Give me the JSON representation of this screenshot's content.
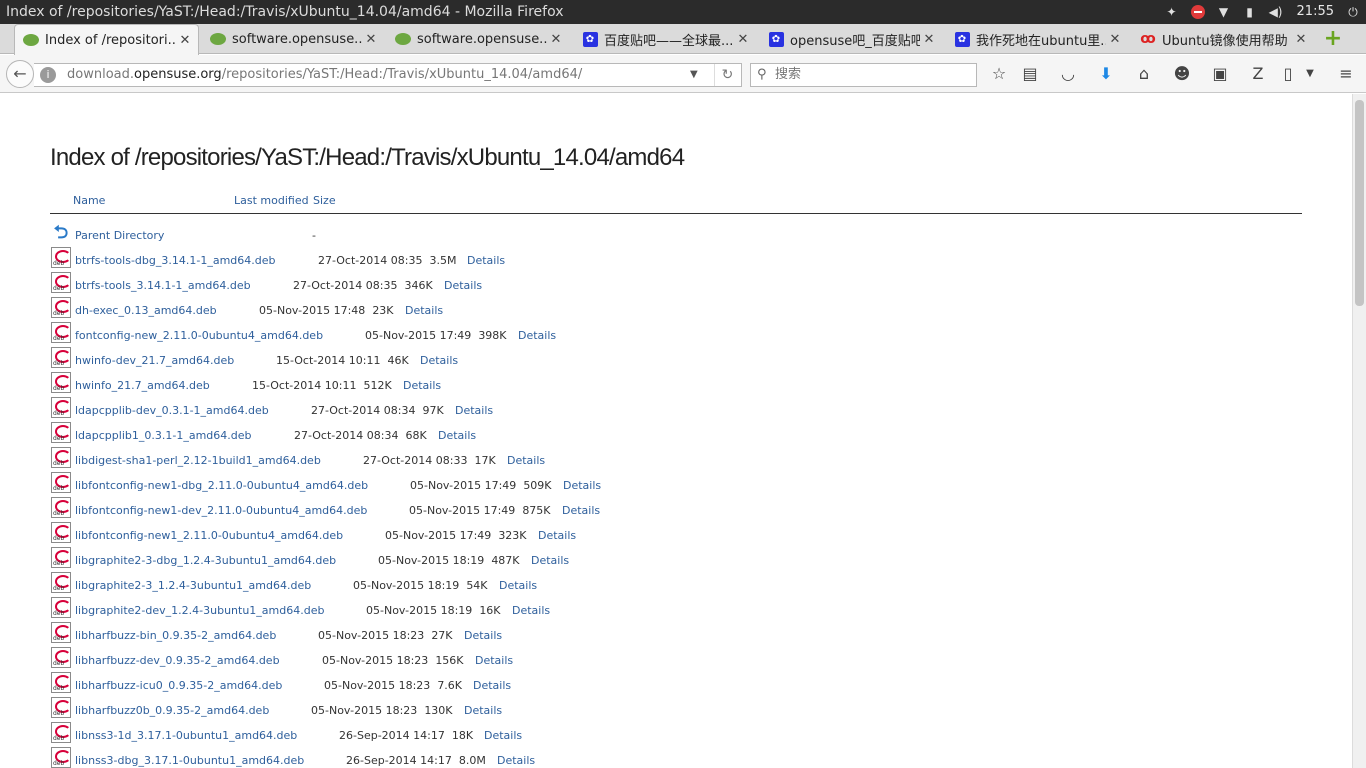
{
  "window": {
    "title": "Index of /repositories/YaST:/Head:/Travis/xUbuntu_14.04/amd64 - Mozilla Firefox"
  },
  "system_tray": {
    "time": "21:55",
    "icons": [
      "network-sparkle-icon",
      "stop-icon",
      "wifi-icon",
      "battery-icon",
      "volume-icon",
      "power-icon"
    ]
  },
  "tabs": [
    {
      "label": "Index of /repositori...",
      "favicon": "opensuse-icon",
      "active": true
    },
    {
      "label": "software.opensuse....",
      "favicon": "opensuse-icon"
    },
    {
      "label": "software.opensuse....",
      "favicon": "opensuse-icon"
    },
    {
      "label": "百度贴吧——全球最...",
      "favicon": "baidu-paw-icon"
    },
    {
      "label": "opensuse吧_百度贴吧",
      "favicon": "baidu-paw-icon"
    },
    {
      "label": "我作死地在ubuntu里...",
      "favicon": "baidu-paw-icon"
    },
    {
      "label": "Ubuntu镜像使用帮助",
      "favicon": "mirror-icon"
    }
  ],
  "navbar": {
    "url_host": "download.opensuse.org",
    "url_path": "/repositories/YaST:/Head:/Travis/xUbuntu_14.04/amd64/",
    "url_prefix": "download.",
    "url_domain": "opensuse.org",
    "search_placeholder": "搜索"
  },
  "page": {
    "title": "Index of /repositories/YaST:/Head:/Travis/xUbuntu_14.04/amd64",
    "col_name": "Name",
    "col_modified": "Last modified",
    "col_size": "Size",
    "parent": {
      "name": "Parent Directory",
      "size": "-"
    },
    "files": [
      {
        "name": "btrfs-tools-dbg_3.14.1-1_amd64.deb",
        "modified": "27-Oct-2014 08:35",
        "size": "3.5M",
        "details": "Details"
      },
      {
        "name": "btrfs-tools_3.14.1-1_amd64.deb",
        "modified": "27-Oct-2014 08:35",
        "size": "346K",
        "details": "Details"
      },
      {
        "name": "dh-exec_0.13_amd64.deb",
        "modified": "05-Nov-2015 17:48",
        "size": "23K",
        "details": "Details"
      },
      {
        "name": "fontconfig-new_2.11.0-0ubuntu4_amd64.deb",
        "modified": "05-Nov-2015 17:49",
        "size": "398K",
        "details": "Details"
      },
      {
        "name": "hwinfo-dev_21.7_amd64.deb",
        "modified": "15-Oct-2014 10:11",
        "size": "46K",
        "details": "Details"
      },
      {
        "name": "hwinfo_21.7_amd64.deb",
        "modified": "15-Oct-2014 10:11",
        "size": "512K",
        "details": "Details"
      },
      {
        "name": "ldapcpplib-dev_0.3.1-1_amd64.deb",
        "modified": "27-Oct-2014 08:34",
        "size": "97K",
        "details": "Details"
      },
      {
        "name": "ldapcpplib1_0.3.1-1_amd64.deb",
        "modified": "27-Oct-2014 08:34",
        "size": "68K",
        "details": "Details"
      },
      {
        "name": "libdigest-sha1-perl_2.12-1build1_amd64.deb",
        "modified": "27-Oct-2014 08:33",
        "size": "17K",
        "details": "Details"
      },
      {
        "name": "libfontconfig-new1-dbg_2.11.0-0ubuntu4_amd64.deb",
        "modified": "05-Nov-2015 17:49",
        "size": "509K",
        "details": "Details"
      },
      {
        "name": "libfontconfig-new1-dev_2.11.0-0ubuntu4_amd64.deb",
        "modified": "05-Nov-2015 17:49",
        "size": "875K",
        "details": "Details"
      },
      {
        "name": "libfontconfig-new1_2.11.0-0ubuntu4_amd64.deb",
        "modified": "05-Nov-2015 17:49",
        "size": "323K",
        "details": "Details"
      },
      {
        "name": "libgraphite2-3-dbg_1.2.4-3ubuntu1_amd64.deb",
        "modified": "05-Nov-2015 18:19",
        "size": "487K",
        "details": "Details"
      },
      {
        "name": "libgraphite2-3_1.2.4-3ubuntu1_amd64.deb",
        "modified": "05-Nov-2015 18:19",
        "size": "54K",
        "details": "Details"
      },
      {
        "name": "libgraphite2-dev_1.2.4-3ubuntu1_amd64.deb",
        "modified": "05-Nov-2015 18:19",
        "size": "16K",
        "details": "Details"
      },
      {
        "name": "libharfbuzz-bin_0.9.35-2_amd64.deb",
        "modified": "05-Nov-2015 18:23",
        "size": "27K",
        "details": "Details"
      },
      {
        "name": "libharfbuzz-dev_0.9.35-2_amd64.deb",
        "modified": "05-Nov-2015 18:23",
        "size": "156K",
        "details": "Details"
      },
      {
        "name": "libharfbuzz-icu0_0.9.35-2_amd64.deb",
        "modified": "05-Nov-2015 18:23",
        "size": "7.6K",
        "details": "Details"
      },
      {
        "name": "libharfbuzz0b_0.9.35-2_amd64.deb",
        "modified": "05-Nov-2015 18:23",
        "size": "130K",
        "details": "Details"
      },
      {
        "name": "libnss3-1d_3.17.1-0ubuntu1_amd64.deb",
        "modified": "26-Sep-2014 14:17",
        "size": "18K",
        "details": "Details"
      },
      {
        "name": "libnss3-dbg_3.17.1-0ubuntu1_amd64.deb",
        "modified": "26-Sep-2014 14:17",
        "size": "8.0M",
        "details": "Details"
      }
    ]
  }
}
